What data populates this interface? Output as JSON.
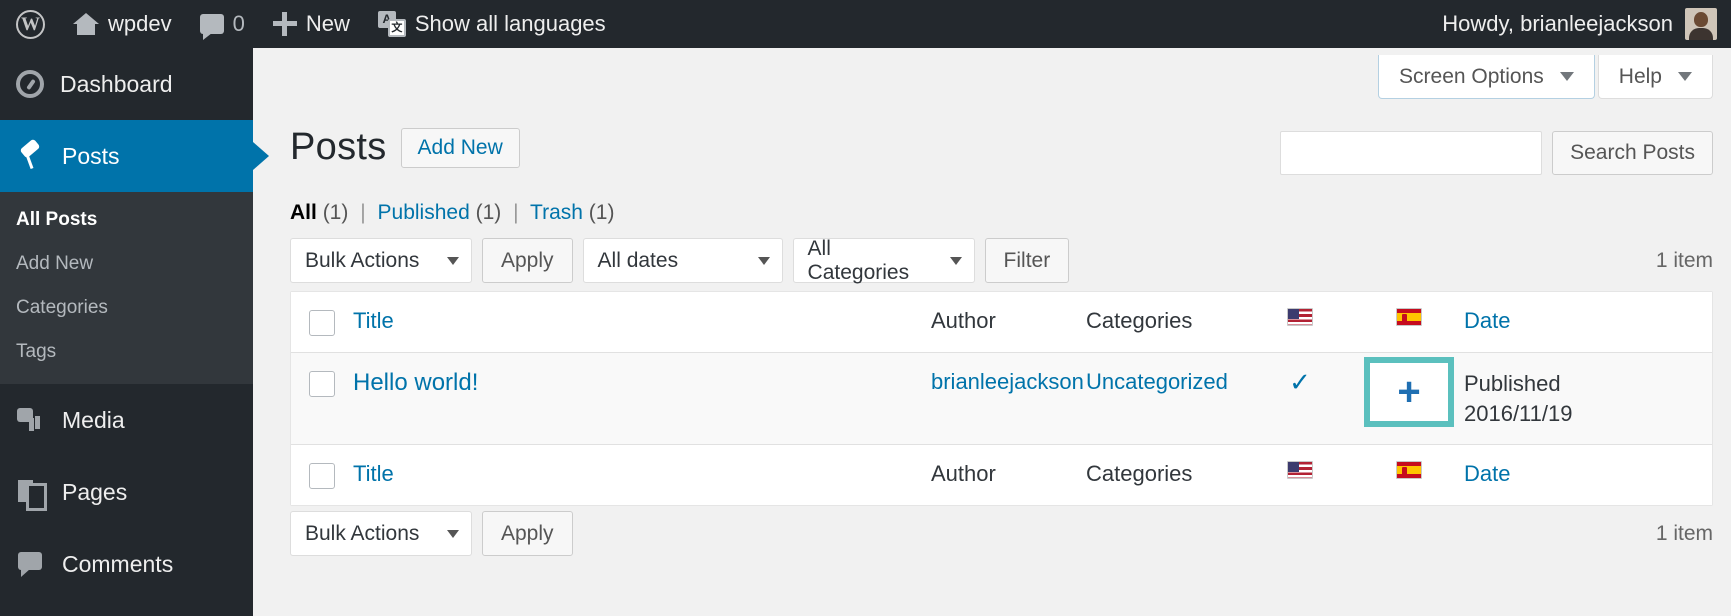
{
  "adminbar": {
    "wp_logo_icon": "wordpress-logo-icon",
    "site_name": "wpdev",
    "comments_count": "0",
    "new_label": "New",
    "languages_label": "Show all languages",
    "languages_icon_a": "A",
    "languages_icon_b": "文",
    "howdy": "Howdy, brianleejackson"
  },
  "sidebar": {
    "items": [
      {
        "label": "Dashboard",
        "icon": "dashboard-gauge-icon",
        "current": false
      },
      {
        "label": "Posts",
        "icon": "pushpin-icon",
        "current": true
      },
      {
        "label": "Media",
        "icon": "media-camera-icon",
        "current": false
      },
      {
        "label": "Pages",
        "icon": "pages-icon",
        "current": false
      },
      {
        "label": "Comments",
        "icon": "comment-bubble-icon",
        "current": false
      }
    ],
    "submenu": [
      {
        "label": "All Posts",
        "current": true
      },
      {
        "label": "Add New",
        "current": false
      },
      {
        "label": "Categories",
        "current": false
      },
      {
        "label": "Tags",
        "current": false
      }
    ]
  },
  "screen_meta": {
    "screen_options": "Screen Options",
    "help": "Help"
  },
  "page": {
    "title": "Posts",
    "add_new": "Add New"
  },
  "views": {
    "all_label": "All",
    "all_count": "(1)",
    "published_label": "Published",
    "published_count": "(1)",
    "trash_label": "Trash",
    "trash_count": "(1)",
    "separator": "|"
  },
  "search": {
    "value": "",
    "placeholder": "",
    "button": "Search Posts"
  },
  "tablenav_top": {
    "bulk_actions": "Bulk Actions",
    "apply": "Apply",
    "all_dates": "All dates",
    "all_categories": "All Categories",
    "filter": "Filter",
    "displaying_num": "1 item"
  },
  "tablenav_bottom": {
    "bulk_actions": "Bulk Actions",
    "apply": "Apply",
    "displaying_num": "1 item"
  },
  "table": {
    "columns": {
      "title": "Title",
      "author": "Author",
      "categories": "Categories",
      "flag_en": "flag-us-icon",
      "flag_es": "flag-spain-icon",
      "date": "Date"
    },
    "rows": [
      {
        "title": "Hello world!",
        "author": "brianleejackson",
        "categories": "Uncategorized",
        "lang_en": "✓",
        "lang_es": "+",
        "date_status": "Published",
        "date_value": "2016/11/19"
      }
    ]
  },
  "colors": {
    "admin_bar": "#23282d",
    "sidebar": "#23282d",
    "submenu": "#32373c",
    "current_menu": "#0073aa",
    "link": "#0073aa",
    "highlight_box": "#5bc0be",
    "page_bg": "#f1f1f1"
  }
}
